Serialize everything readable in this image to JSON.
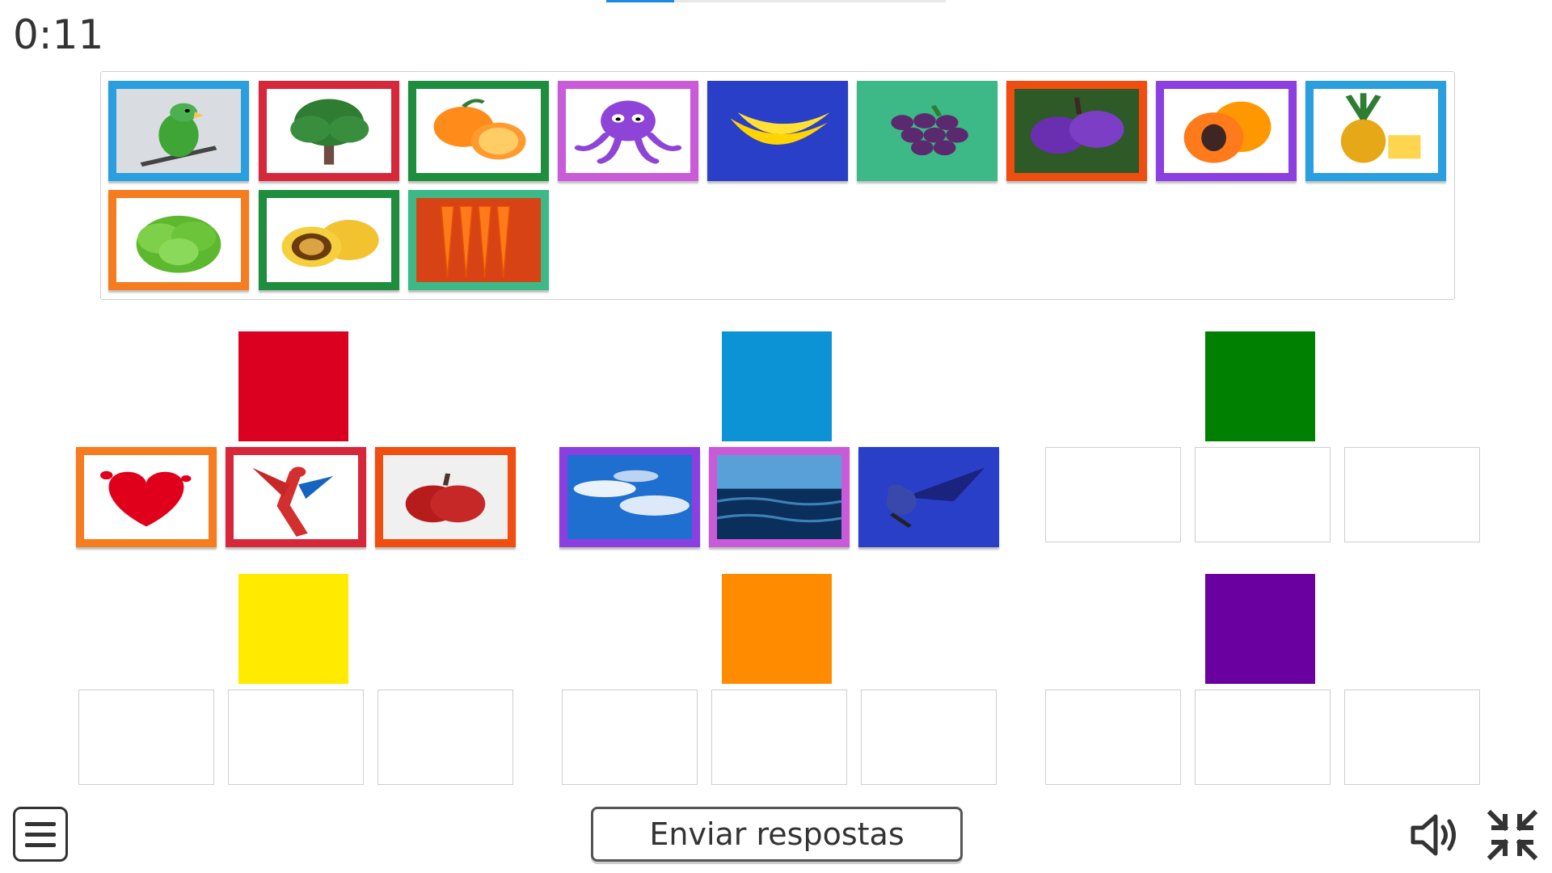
{
  "header": {
    "timer": "0:11",
    "progress_fraction": 0.2
  },
  "toolbar": {
    "submit_label": "Enviar respostas"
  },
  "pool_cards": [
    {
      "id": "parrot-green",
      "frame": "#2a9fe0"
    },
    {
      "id": "tree",
      "frame": "#d6283a"
    },
    {
      "id": "oranges",
      "frame": "#1e8e3e"
    },
    {
      "id": "octopus",
      "frame": "#c95ad8"
    },
    {
      "id": "bananas",
      "frame": "#2a3fc8"
    },
    {
      "id": "grapes",
      "frame": "#3db887"
    },
    {
      "id": "plums",
      "frame": "#f04d10"
    },
    {
      "id": "papaya",
      "frame": "#8b3fe0"
    },
    {
      "id": "pineapple",
      "frame": "#2a9fe0"
    },
    {
      "id": "lettuce",
      "frame": "#f57c1f"
    },
    {
      "id": "passion-fruit",
      "frame": "#1e8e3e"
    },
    {
      "id": "carrots",
      "frame": "#3db887"
    }
  ],
  "categories": [
    {
      "name": "red",
      "color": "#dc0020",
      "placed": [
        {
          "id": "heart",
          "frame": "#f57c1f"
        },
        {
          "id": "scarlet-macaw",
          "frame": "#d6283a"
        },
        {
          "id": "apple",
          "frame": "#f04d10"
        }
      ]
    },
    {
      "name": "blue",
      "color": "#0b93d6",
      "placed": [
        {
          "id": "sky",
          "frame": "#8b3fe0"
        },
        {
          "id": "sea",
          "frame": "#c95ad8"
        },
        {
          "id": "blue-macaw",
          "frame": "#2a3fc8"
        }
      ]
    },
    {
      "name": "green",
      "color": "#008000",
      "placed": []
    },
    {
      "name": "yellow",
      "color": "#ffea00",
      "placed": []
    },
    {
      "name": "orange",
      "color": "#ff8c00",
      "placed": []
    },
    {
      "name": "purple",
      "color": "#6a00a0",
      "placed": []
    }
  ],
  "icons": {
    "menu": "menu-icon",
    "sound": "speaker-icon",
    "exit_fullscreen": "collapse-icon"
  }
}
